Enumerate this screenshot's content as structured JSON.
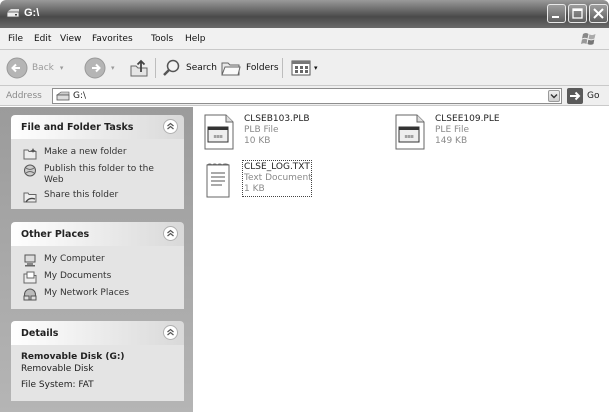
{
  "window": {
    "title": "G:\\"
  },
  "menu": [
    "File",
    "Edit",
    "View",
    "Favorites",
    "Tools",
    "Help"
  ],
  "toolbar": {
    "back_label": "Back",
    "search_label": "Search",
    "folders_label": "Folders"
  },
  "address": {
    "label": "Address",
    "value": "G:\\",
    "go_label": "Go"
  },
  "panels": {
    "file_tasks": {
      "title": "File and Folder Tasks",
      "items": [
        {
          "label": "Make a new folder",
          "icon": "new-folder-icon"
        },
        {
          "label": "Publish this folder to the Web",
          "icon": "web-publish-icon"
        },
        {
          "label": "Share this folder",
          "icon": "share-folder-icon"
        }
      ]
    },
    "other_places": {
      "title": "Other Places",
      "items": [
        {
          "label": "My Computer",
          "icon": "my-computer-icon"
        },
        {
          "label": "My Documents",
          "icon": "my-documents-icon"
        },
        {
          "label": "My Network Places",
          "icon": "network-places-icon"
        }
      ]
    },
    "details": {
      "title": "Details",
      "name": "Removable Disk (G:)",
      "type": "Removable Disk",
      "filesystem": "File System: FAT"
    }
  },
  "files": [
    {
      "name": "CLSEB103.PLB",
      "type": "PLB File",
      "size": "10 KB",
      "icon": "application-file-icon"
    },
    {
      "name": "CLSEE109.PLE",
      "type": "PLE File",
      "size": "149 KB",
      "icon": "application-file-icon"
    },
    {
      "name": "CLSE_LOG.TXT",
      "type": "Text Document",
      "size": "1 KB",
      "icon": "text-document-icon"
    }
  ]
}
